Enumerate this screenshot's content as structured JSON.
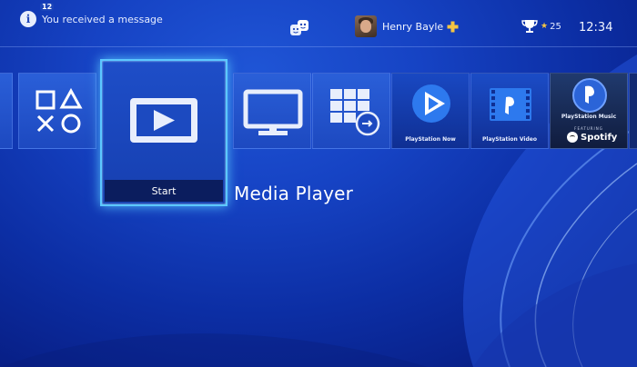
{
  "topbar": {
    "notification_count": "12",
    "notification_text": "You received a message",
    "user_name": "Henry Bayle",
    "trophy_level": "25",
    "clock": "12:34"
  },
  "tiles": {
    "selected_action": "Start",
    "selected_title": "Media Player",
    "playstation_now_label": "PlayStation Now",
    "playstation_video_label": "PlayStation Video",
    "playstation_music_label": "PlayStation Music",
    "music_sub_label": "FEATURING",
    "spotify_label": "Spotify"
  },
  "colors": {
    "accent_glow": "#5cc8ff",
    "background": "#1643c4",
    "plus_yellow": "#f4c542"
  },
  "icons": {
    "notification": "info-icon",
    "friends": "friends-icon",
    "plus": "playstation-plus-icon",
    "trophy": "trophy-icon"
  }
}
